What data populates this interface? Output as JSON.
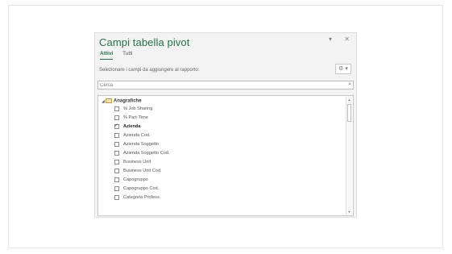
{
  "pane": {
    "title": "Campi tabella pivot",
    "dropdown_glyph": "▾",
    "close_glyph": "✕",
    "tabs": [
      {
        "label": "Attivi",
        "active": true
      },
      {
        "label": "Tutti",
        "active": false
      }
    ],
    "hint": "Selezionare i campi da aggiungere al rapporto:",
    "gear_label": "⚙ ▾",
    "search": {
      "placeholder": "Cerca",
      "icon": "search-icon"
    },
    "group": {
      "arrow": "◢",
      "label": "Anagrafiche",
      "icon": "table-icon"
    },
    "fields": [
      {
        "label": "% Job Sharing",
        "checked": false
      },
      {
        "label": "% Part-Time",
        "checked": false
      },
      {
        "label": "Azienda",
        "checked": true
      },
      {
        "label": "Azienda Cod.",
        "checked": false
      },
      {
        "label": "Azienda Soggetto",
        "checked": false
      },
      {
        "label": "Azienda Soggetto Cod.",
        "checked": false
      },
      {
        "label": "Business Unit",
        "checked": false
      },
      {
        "label": "Business Unit Cod.",
        "checked": false
      },
      {
        "label": "Capogruppo",
        "checked": false
      },
      {
        "label": "Capogruppo Cod.",
        "checked": false
      },
      {
        "label": "Categoria Profess.",
        "checked": false
      }
    ],
    "scroll_up": "▲",
    "scroll_down": "▼"
  },
  "colors": {
    "accent": "#217346",
    "search_icon": "#2b6cb3"
  }
}
